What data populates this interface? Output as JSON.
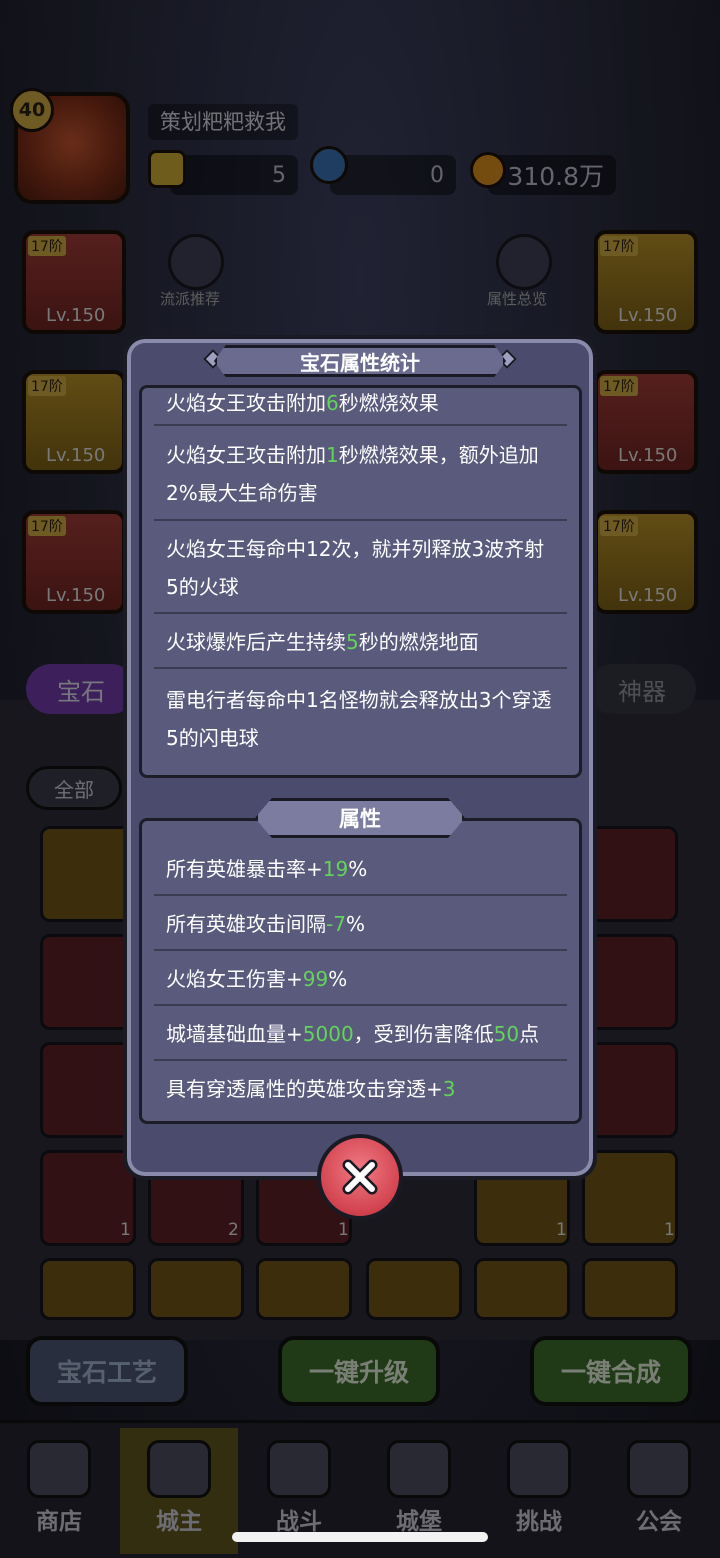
{
  "player": {
    "level": "40",
    "name": "策划粑粑救我",
    "gems": "5",
    "potions": "0",
    "gold": "310.8万"
  },
  "left_menu": {
    "recommend": "流派推荐",
    "overview": "属性总览"
  },
  "equipment": {
    "tier_label": "17阶",
    "level_label": "Lv.150"
  },
  "tabs": {
    "gem": "宝石",
    "artifact": "神器"
  },
  "filter": {
    "all": "全部"
  },
  "gem_counts": {
    "c1": "1",
    "c2": "2",
    "c3": "1",
    "c4": "1",
    "c5": "1"
  },
  "action_buttons": {
    "craft": "宝石工艺",
    "upgrade": "一键升级",
    "merge": "一键合成"
  },
  "bottom_nav": {
    "shop": "商店",
    "lord": "城主",
    "battle": "战斗",
    "castle": "城堡",
    "challenge": "挑战",
    "guild": "公会"
  },
  "modal": {
    "title": "宝石属性统计",
    "effects": [
      {
        "pre": "火焰女王攻击附加",
        "num": "6",
        "post": "秒燃烧效果"
      },
      {
        "pre": "火焰女王攻击附加",
        "num": "1",
        "post": "秒燃烧效果，额外追加2%最大生命伤害"
      },
      {
        "pre": "火焰女王每命中12次，就并列释放3波齐射5的火球",
        "num": "",
        "post": ""
      },
      {
        "pre": "火球爆炸后产生持续",
        "num": "5",
        "post": "秒的燃烧地面"
      },
      {
        "pre": "雷电行者每命中1名怪物就会释放出3个穿透5的闪电球",
        "num": "",
        "post": ""
      }
    ],
    "attributes_title": "属性",
    "attributes": [
      {
        "pre": "所有英雄暴击率+",
        "num": "19",
        "post": "%",
        "num2": "",
        "post2": ""
      },
      {
        "pre": "所有英雄攻击间隔",
        "num": "-7",
        "post": "%",
        "num2": "",
        "post2": ""
      },
      {
        "pre": "火焰女王伤害+",
        "num": "99",
        "post": "%",
        "num2": "",
        "post2": ""
      },
      {
        "pre": "城墙基础血量+",
        "num": "5000",
        "post": "，受到伤害降低",
        "num2": "50",
        "post2": "点"
      },
      {
        "pre": "具有穿透属性的英雄攻击穿透+",
        "num": "3",
        "post": "",
        "num2": "",
        "post2": ""
      }
    ],
    "close_icon": "close-x-icon"
  },
  "colors": {
    "accent_green": "#63d35a",
    "panel": "#595a7c",
    "modal_bg": "#4b4c6d",
    "close_red": "#d2434f"
  }
}
